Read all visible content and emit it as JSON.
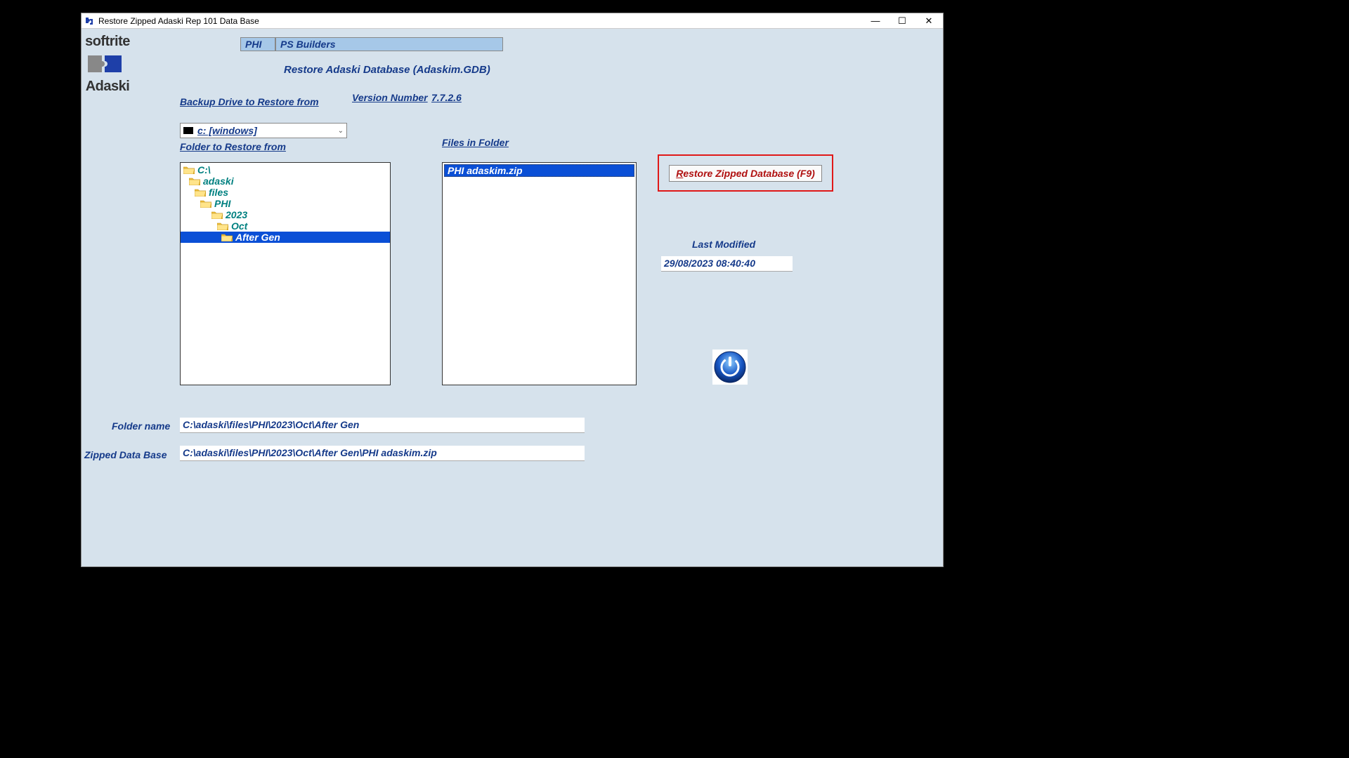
{
  "window": {
    "title": "Restore Zipped Adaski Rep 101 Data Base"
  },
  "logo": {
    "top": "softrite",
    "bottom": "Adaski"
  },
  "header": {
    "code": "PHI",
    "name": "PS Builders"
  },
  "subtitle": "Restore Adaski  Database (Adaskim.GDB)",
  "labels": {
    "backup_drive": "Backup Drive to Restore from",
    "version_label": "Version Number",
    "version_value": "7.7.2.6",
    "folder_restore": "Folder to Restore from",
    "files_in_folder": "Files in Folder",
    "last_modified": "Last Modified",
    "folder_name": "Folder name",
    "zipped_db": "Zipped Data Base"
  },
  "drive": {
    "selected": "c: [windows]"
  },
  "tree": [
    {
      "label": "C:\\",
      "indent": 1,
      "selected": false
    },
    {
      "label": "adaski",
      "indent": 2,
      "selected": false
    },
    {
      "label": "files",
      "indent": 3,
      "selected": false
    },
    {
      "label": "PHI",
      "indent": 4,
      "selected": false
    },
    {
      "label": "2023",
      "indent": 5,
      "selected": false
    },
    {
      "label": "Oct",
      "indent": 6,
      "selected": false
    },
    {
      "label": "After Gen",
      "indent": 7,
      "selected": true
    }
  ],
  "files": [
    {
      "name": "PHI adaskim.zip",
      "selected": true
    }
  ],
  "restore_button": {
    "prefix": "R",
    "rest": "estore Zipped Database (F9)"
  },
  "last_modified_value": "29/08/2023 08:40:40",
  "folder_name_value": "C:\\adaski\\files\\PHI\\2023\\Oct\\After Gen",
  "zipped_value": "C:\\adaski\\files\\PHI\\2023\\Oct\\After Gen\\PHI adaskim.zip"
}
